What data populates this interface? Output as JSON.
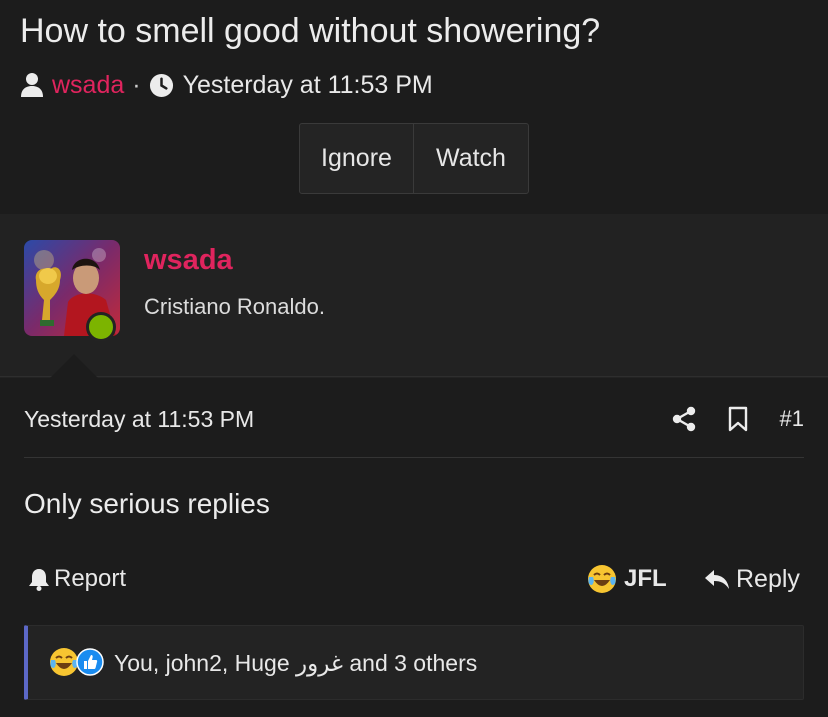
{
  "thread": {
    "title": "How to smell good without showering?",
    "author": "wsada",
    "separator": "·",
    "date": "Yesterday at 11:53 PM"
  },
  "buttons": {
    "ignore": "Ignore",
    "watch": "Watch"
  },
  "post": {
    "username": "wsada",
    "user_title": "Cristiano Ronaldo.",
    "date": "Yesterday at 11:53 PM",
    "post_number": "#1",
    "message": "Only serious replies",
    "report_label": "Report",
    "reaction_label": "JFL",
    "reply_label": "Reply",
    "reactions_summary": "You, john2, Huge غرور and 3 others"
  },
  "colors": {
    "accent": "#e0245e",
    "online": "#7cb400",
    "reaction_border": "#5c68c7",
    "like_blue": "#1a8cf0"
  },
  "icons": [
    "user-icon",
    "clock-icon",
    "share-icon",
    "bookmark-icon",
    "bell-icon",
    "laugh-cry-emoji-icon",
    "reply-icon",
    "thumbs-up-icon"
  ]
}
